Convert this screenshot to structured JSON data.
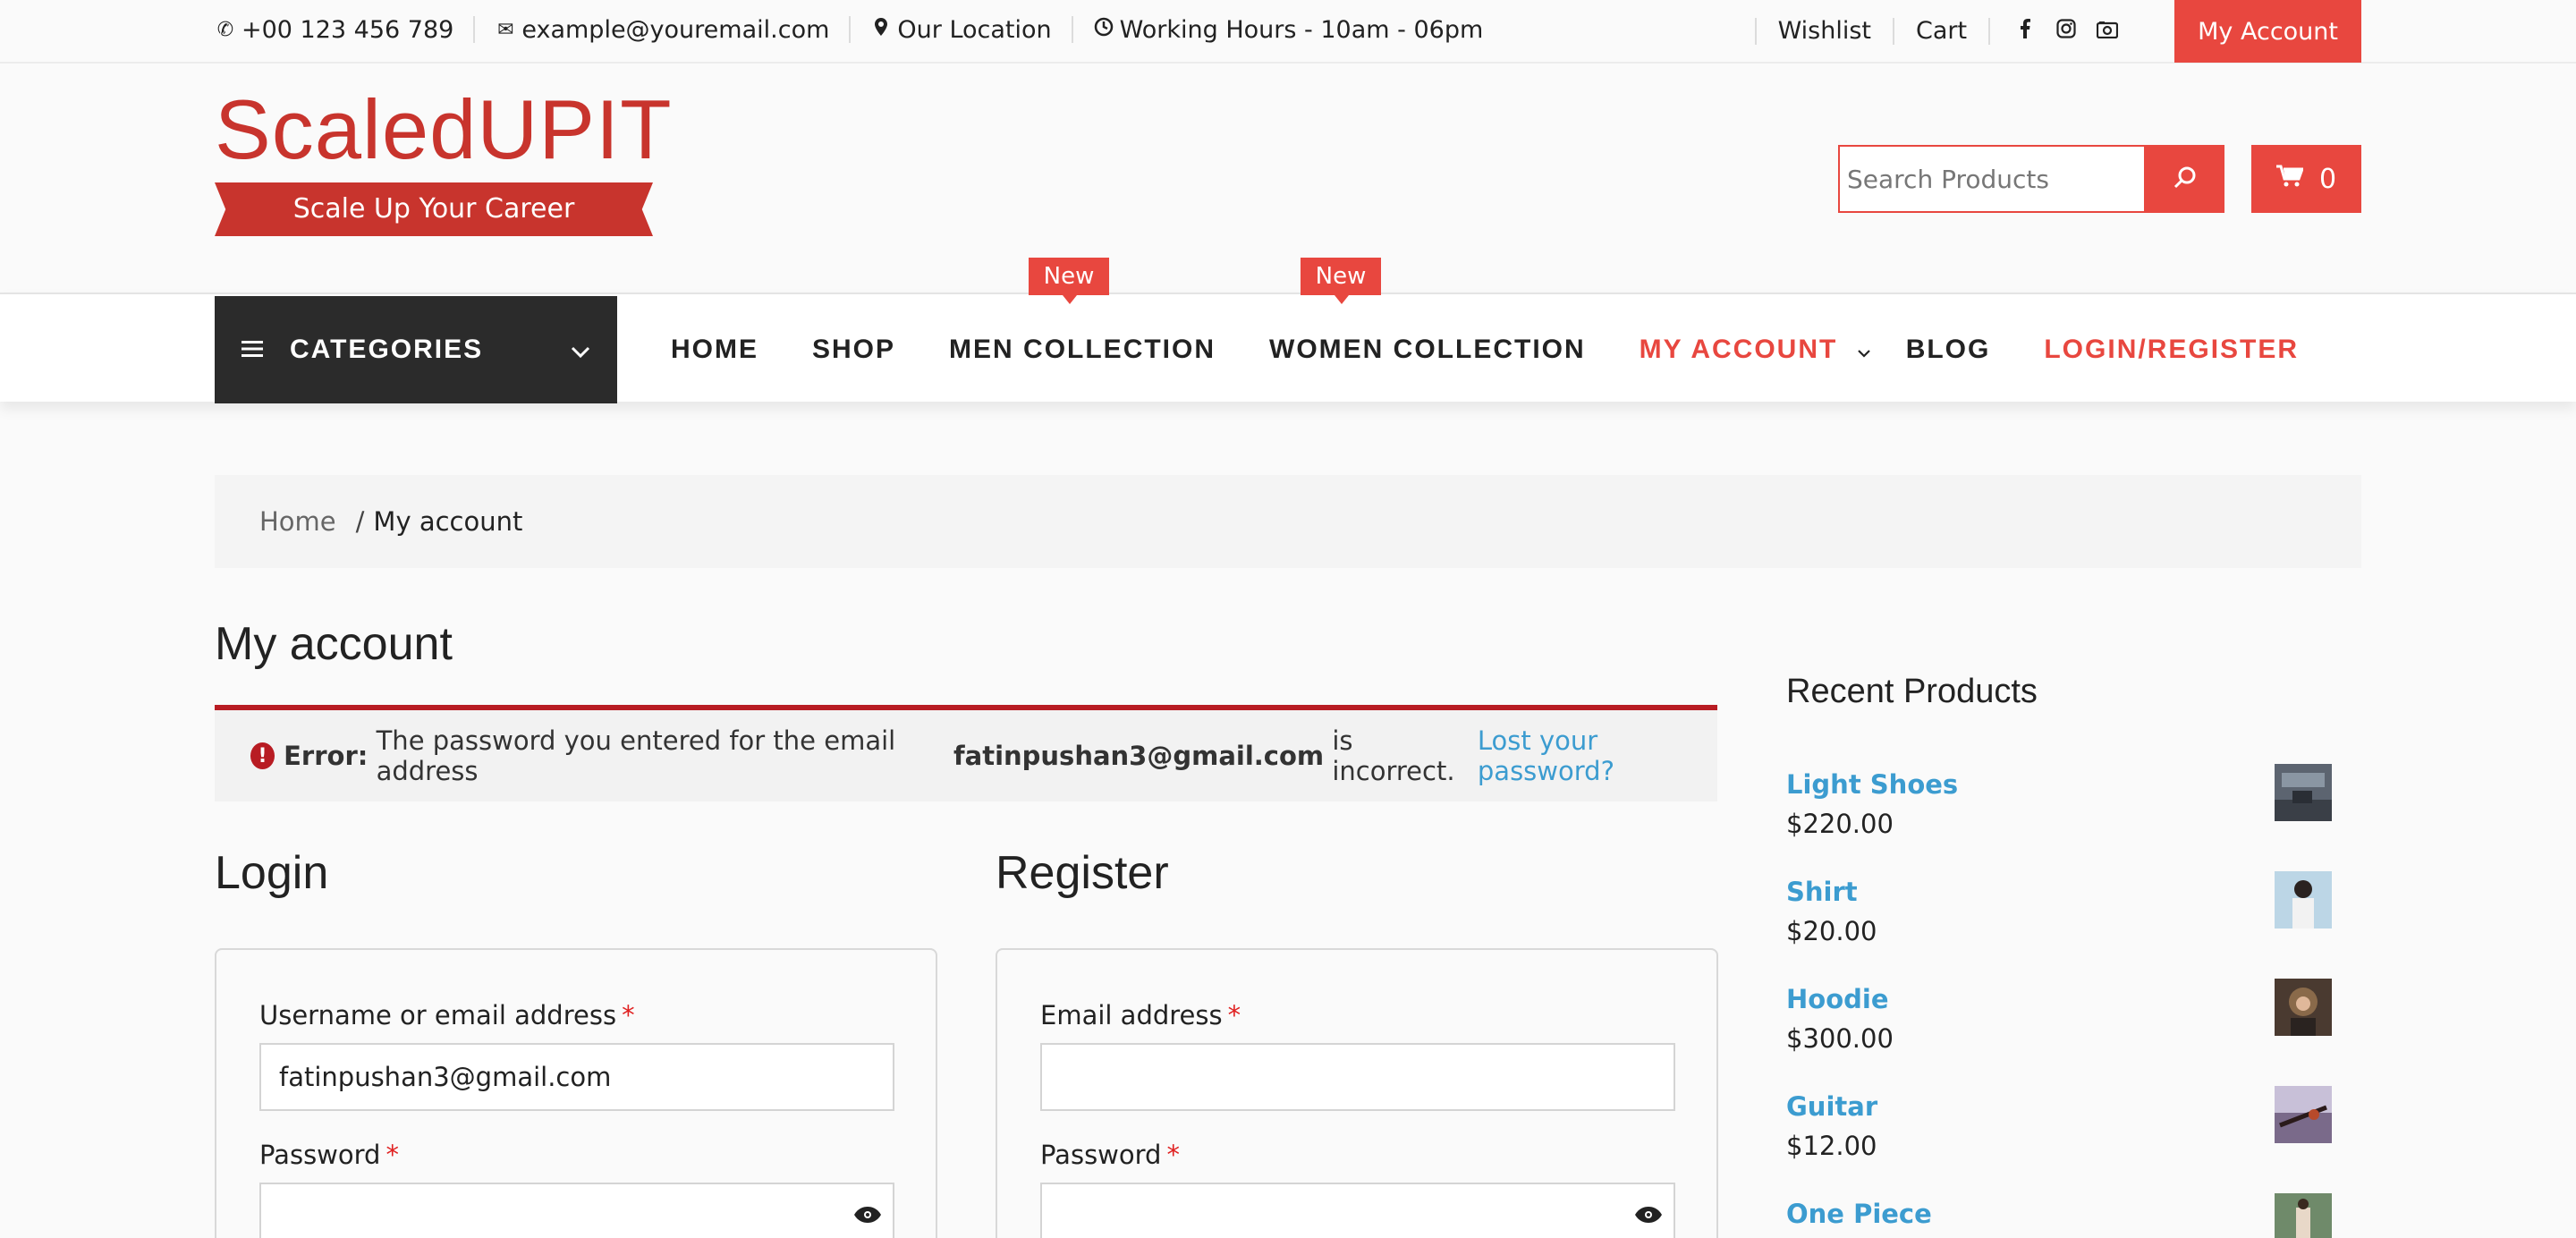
{
  "topbar": {
    "phone": "+00 123 456 789",
    "email": "example@youremail.com",
    "location": "Our Location",
    "hours": "Working Hours - 10am - 06pm",
    "wishlist": "Wishlist",
    "cart": "Cart",
    "social": [
      "facebook-icon",
      "instagram-icon",
      "camera-icon"
    ],
    "my_account": "My Account"
  },
  "header": {
    "logo_title": "ScaledUPIT",
    "logo_tagline": "Scale Up Your Career",
    "search_placeholder": "Search Products",
    "cart_count": "0"
  },
  "nav": {
    "categories": "CATEGORIES",
    "items": [
      {
        "label": "HOME"
      },
      {
        "label": "SHOP"
      },
      {
        "label": "MEN COLLECTION",
        "badge": "New"
      },
      {
        "label": "WOMEN COLLECTION",
        "badge": "New"
      },
      {
        "label": "MY ACCOUNT"
      },
      {
        "label": "BLOG"
      },
      {
        "label": "LOGIN/REGISTER"
      }
    ]
  },
  "breadcrumb": {
    "home": "Home",
    "separator": "/",
    "current": "My account"
  },
  "main": {
    "title": "My account",
    "error": {
      "prefix": "Error:",
      "text_before": "The password you entered for the email address",
      "email": "fatinpushan3@gmail.com",
      "text_after": "is incorrect.",
      "link": "Lost your password?"
    },
    "login": {
      "title": "Login",
      "username_label": "Username or email address",
      "username_value": "fatinpushan3@gmail.com",
      "password_label": "Password",
      "required_mark": "*"
    },
    "register": {
      "title": "Register",
      "email_label": "Email address",
      "email_value": "",
      "password_label": "Password",
      "required_mark": "*"
    }
  },
  "sidebar": {
    "title": "Recent Products",
    "products": [
      {
        "name": "Light Shoes",
        "price": "$220.00"
      },
      {
        "name": "Shirt",
        "price": "$20.00"
      },
      {
        "name": "Hoodie",
        "price": "$300.00"
      },
      {
        "name": "Guitar",
        "price": "$12.00"
      },
      {
        "name": "One Piece",
        "price": ""
      }
    ]
  },
  "colors": {
    "accent": "#e8473f",
    "logo_red": "#c8342d",
    "error_red": "#b81c23",
    "link_blue": "#3c9cd0",
    "dark": "#2b2b2b"
  }
}
